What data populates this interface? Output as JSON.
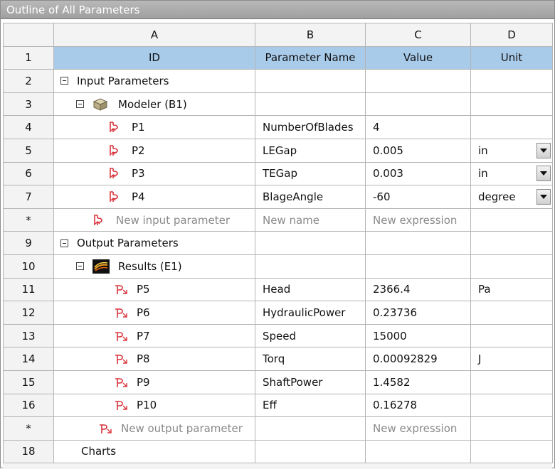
{
  "window": {
    "title": "Outline of All Parameters"
  },
  "columns": {
    "a": "A",
    "b": "B",
    "c": "C",
    "d": "D"
  },
  "header_row": {
    "num": "1",
    "id": "ID",
    "name": "Parameter Name",
    "value": "Value",
    "unit": "Unit"
  },
  "groups": {
    "input": {
      "num": "2",
      "label": "Input Parameters"
    },
    "modeler": {
      "num": "3",
      "label": "Modeler (B1)"
    },
    "output": {
      "num": "9",
      "label": "Output Parameters"
    },
    "results": {
      "num": "10",
      "label": "Results (E1)"
    }
  },
  "inputs": [
    {
      "num": "4",
      "id": "P1",
      "name": "NumberOfBlades",
      "value": "4",
      "unit": ""
    },
    {
      "num": "5",
      "id": "P2",
      "name": "LEGap",
      "value": "0.005",
      "unit": "in"
    },
    {
      "num": "6",
      "id": "P3",
      "name": "TEGap",
      "value": "0.003",
      "unit": "in"
    },
    {
      "num": "7",
      "id": "P4",
      "name": "BlageAngle",
      "value": "-60",
      "unit": "degree"
    }
  ],
  "new_input": {
    "num": "*",
    "id": "New input parameter",
    "name": "New name",
    "value": "New expression"
  },
  "outputs": [
    {
      "num": "11",
      "id": "P5",
      "name": "Head",
      "value": "2366.4",
      "unit": "Pa"
    },
    {
      "num": "12",
      "id": "P6",
      "name": "HydraulicPower",
      "value": "0.23736",
      "unit": ""
    },
    {
      "num": "13",
      "id": "P7",
      "name": "Speed",
      "value": "15000",
      "unit": ""
    },
    {
      "num": "14",
      "id": "P8",
      "name": "Torq",
      "value": "0.00092829",
      "unit": "J"
    },
    {
      "num": "15",
      "id": "P9",
      "name": "ShaftPower",
      "value": "1.4582",
      "unit": ""
    },
    {
      "num": "16",
      "id": "P10",
      "name": "Eff",
      "value": "0.16278",
      "unit": ""
    }
  ],
  "new_output": {
    "num": "*",
    "id": "New output parameter",
    "value": "New expression"
  },
  "charts": {
    "num": "18",
    "label": "Charts"
  },
  "icons": {
    "input_param": "input-parameter-icon",
    "output_param": "output-parameter-icon",
    "modeler": "modeler-cube-icon",
    "results": "results-icon",
    "expander": "collapse-icon"
  }
}
